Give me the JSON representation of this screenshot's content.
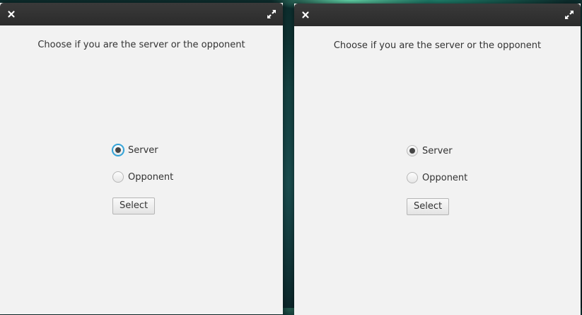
{
  "windows": [
    {
      "prompt": "Choose if you are the server or the opponent",
      "options": [
        {
          "label": "Server",
          "checked": true,
          "focused": true
        },
        {
          "label": "Opponent",
          "checked": false,
          "focused": false
        }
      ],
      "button_label": "Select"
    },
    {
      "prompt": "Choose if you are the server or the opponent",
      "options": [
        {
          "label": "Server",
          "checked": true,
          "focused": false
        },
        {
          "label": "Opponent",
          "checked": false,
          "focused": false
        }
      ],
      "button_label": "Select"
    }
  ],
  "icons": {
    "close": "close-icon",
    "maximize": "maximize-icon"
  },
  "colors": {
    "titlebar": "#2b2b2b",
    "window_bg": "#f2f2f2",
    "focus_ring": "#2a9fd6"
  }
}
